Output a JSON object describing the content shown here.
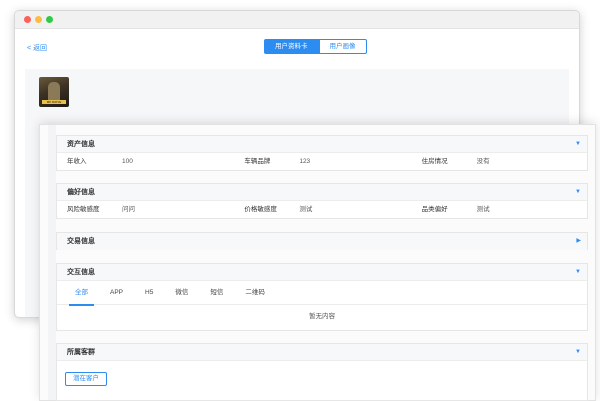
{
  "window": {
    "back_label": "< 返回",
    "tabs": [
      {
        "label": "用户资料卡",
        "active": true
      },
      {
        "label": "用户画像",
        "active": false
      }
    ],
    "avatar_caption": "MP DRIVE"
  },
  "sections": {
    "assets": {
      "title": "资产信息",
      "fields": [
        {
          "label": "年收入",
          "value": "100"
        },
        {
          "label": "车辆品牌",
          "value": "123"
        },
        {
          "label": "住房情况",
          "value": "没有"
        }
      ]
    },
    "preferences": {
      "title": "偏好信息",
      "fields": [
        {
          "label": "风险敏感度",
          "value": "问问"
        },
        {
          "label": "价格敏感度",
          "value": "测试"
        },
        {
          "label": "品类偏好",
          "value": "测试"
        }
      ]
    },
    "trade": {
      "title": "交易信息"
    },
    "interaction": {
      "title": "交互信息",
      "tabs": [
        "全部",
        "APP",
        "H5",
        "微信",
        "短信",
        "二维码"
      ],
      "empty_text": "暂无内容"
    },
    "groups": {
      "title": "所属客群",
      "tag": "潜在客户"
    }
  },
  "colors": {
    "accent": "#2d8cf0"
  }
}
